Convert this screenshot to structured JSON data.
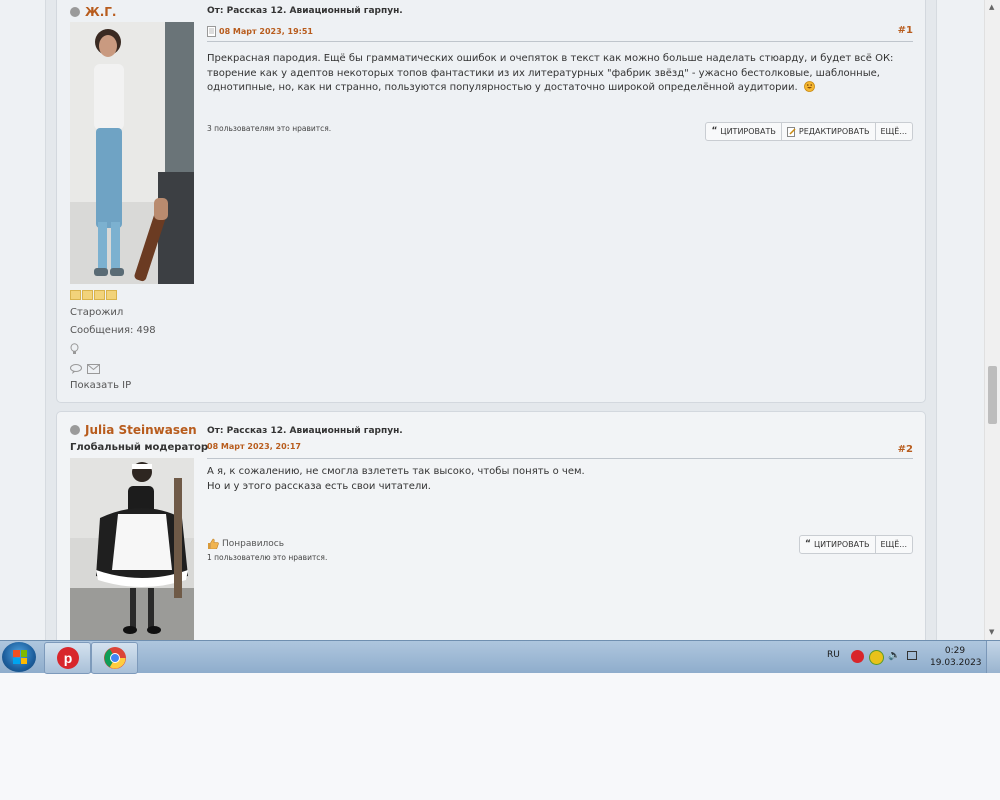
{
  "posts": [
    {
      "author": "Ж.Г.",
      "subject": "От: Рассказ 12. Авиационный гарпун.",
      "date": "08 Март 2023, 19:51",
      "number": "#1",
      "body": "Прекрасная пародия. Ещё бы грамматических ошибок и очепяток в текст как можно больше наделать стюарду, и будет всё ОК: творение как у адептов некоторых топов фантастики из их литературных \"фабрик звёзд\" - ужасно бестолковые, шаблонные, однотипные, но, как ни странно, пользуются популярностью у достаточно широкой определённой аудитории.",
      "likes_text": "3 пользователям это нравится.",
      "rank": "Старожил",
      "messages": "Сообщения: 498",
      "show_ip": "Показать IP",
      "buttons": {
        "quote": "ЦИТИРОВАТЬ",
        "edit": "РЕДАКТИРОВАТЬ",
        "more": "ЕЩЁ..."
      }
    },
    {
      "author": "Julia Steinwasen",
      "role": "Глобальный модератор",
      "subject": "От: Рассказ 12. Авиационный гарпун.",
      "date": "08 Март 2023, 20:17",
      "number": "#2",
      "body_line1": "А я, к сожалению,  не смогла взлететь так высоко, чтобы понять о чем.",
      "body_line2": "Но и у этого рассказа есть свои читатели.",
      "like_label": "Понравилось",
      "likes_text": "1 пользователю это нравится.",
      "buttons": {
        "quote": "ЦИТИРОВАТЬ",
        "more": "ЕЩЁ..."
      }
    }
  ],
  "taskbar": {
    "language": "RU",
    "time": "0:29",
    "date": "19.03.2023"
  },
  "colors": {
    "accent": "#b85c1d",
    "taskbar": "#9db8d4"
  }
}
